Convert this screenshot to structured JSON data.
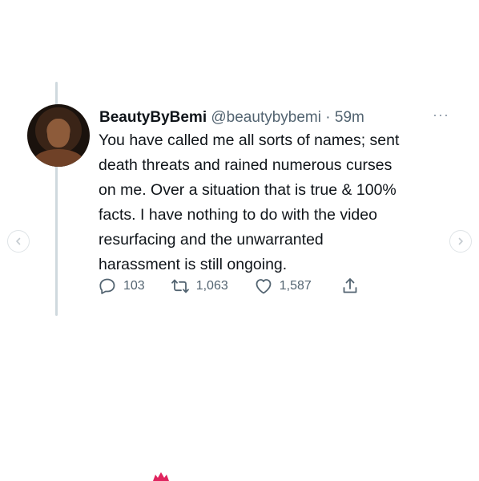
{
  "tweet": {
    "display_name": "BeautyByBemi",
    "handle": "@beautybybemi",
    "separator": "·",
    "time": "59m",
    "text": "You have called me all sorts of names; sent\ndeath threats and rained numerous curses\non me. Over a situation that is true & 100%\nfacts. I have nothing to do with the video\nresurfacing and the unwarranted\nharassment is still ongoing.",
    "more": "···"
  },
  "actions": {
    "reply": {
      "icon": "reply-icon",
      "count": "103"
    },
    "retweet": {
      "icon": "retweet-icon",
      "count": "1,063"
    },
    "like": {
      "icon": "heart-icon",
      "count": "1,587"
    },
    "share": {
      "icon": "share-icon"
    }
  },
  "carousel": {
    "prev_icon": "chevron-left-icon",
    "next_icon": "chevron-right-icon"
  },
  "colors": {
    "text": "#0f1419",
    "secondary": "#536471",
    "thread_line": "#cfd9de",
    "accent_red": "#e0245e"
  }
}
